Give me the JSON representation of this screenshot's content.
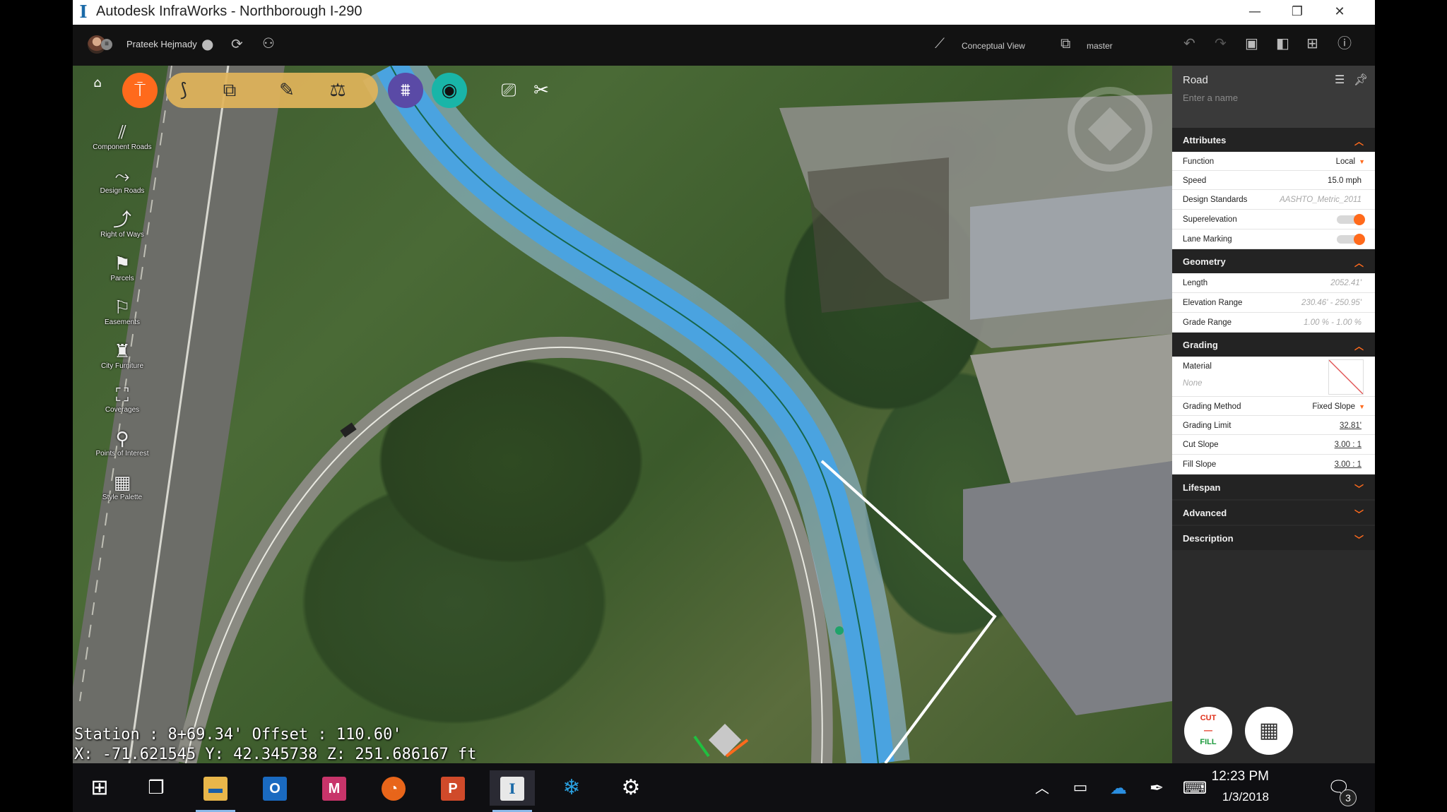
{
  "window": {
    "title": "Autodesk InfraWorks - Northborough I-290",
    "minimize_glyph": "—",
    "restore_glyph": "❐",
    "close_glyph": "✕"
  },
  "toolbar": {
    "user_name": "Prateek Hejmady",
    "view_mode": "Conceptual View",
    "branch": "master"
  },
  "viewport": {
    "side_tools": [
      {
        "label": "Component Roads",
        "icon": "component-roads-icon",
        "glyph": "⫽"
      },
      {
        "label": "Design Roads",
        "icon": "design-roads-icon",
        "glyph": "⤳"
      },
      {
        "label": "Right of Ways",
        "icon": "right-of-ways-icon",
        "glyph": "⤴"
      },
      {
        "label": "Parcels",
        "icon": "parcels-icon",
        "glyph": "⚑"
      },
      {
        "label": "Easements",
        "icon": "easements-icon",
        "glyph": "⚐"
      },
      {
        "label": "City Furniture",
        "icon": "city-furniture-icon",
        "glyph": "♜"
      },
      {
        "label": "Coverages",
        "icon": "coverages-icon",
        "glyph": "⛶"
      },
      {
        "label": "Points of Interest",
        "icon": "points-of-interest-icon",
        "glyph": "⚲"
      },
      {
        "label": "Style Palette",
        "icon": "style-palette-icon",
        "glyph": "▦"
      }
    ],
    "station_readout": "Station : 8+69.34' Offset : 110.60'",
    "coord_readout": "X: -71.621545 Y: 42.345738 Z: 251.686167 ft"
  },
  "panel": {
    "title": "Road",
    "name_placeholder": "Enter a name",
    "attributes": {
      "header": "Attributes",
      "function_label": "Function",
      "function_value": "Local",
      "speed_label": "Speed",
      "speed_value": "15.0 mph",
      "design_standards_label": "Design Standards",
      "design_standards_value": "AASHTO_Metric_2011",
      "superelevation_label": "Superelevation",
      "lane_marking_label": "Lane Marking"
    },
    "geometry": {
      "header": "Geometry",
      "length_label": "Length",
      "length_value": "2052.41'",
      "elevation_range_label": "Elevation Range",
      "elevation_range_value": "230.46' - 250.95'",
      "grade_range_label": "Grade Range",
      "grade_range_value": "1.00 % - 1.00 %"
    },
    "grading": {
      "header": "Grading",
      "material_label": "Material",
      "material_value": "None",
      "grading_method_label": "Grading Method",
      "grading_method_value": "Fixed Slope",
      "grading_limit_label": "Grading Limit",
      "grading_limit_value": "32.81'",
      "cut_slope_label": "Cut Slope",
      "cut_slope_value": "3.00 : 1",
      "fill_slope_label": "Fill Slope",
      "fill_slope_value": "3.00 : 1"
    },
    "lifespan_header": "Lifespan",
    "advanced_header": "Advanced",
    "description_header": "Description",
    "cut_label": "CUT",
    "fill_label": "FILL"
  },
  "taskbar": {
    "time": "12:23 PM",
    "date": "1/3/2018",
    "notification_count": "3"
  },
  "colors": {
    "accent": "#ff6a1c",
    "road_highlight": "#4aa3e0"
  }
}
